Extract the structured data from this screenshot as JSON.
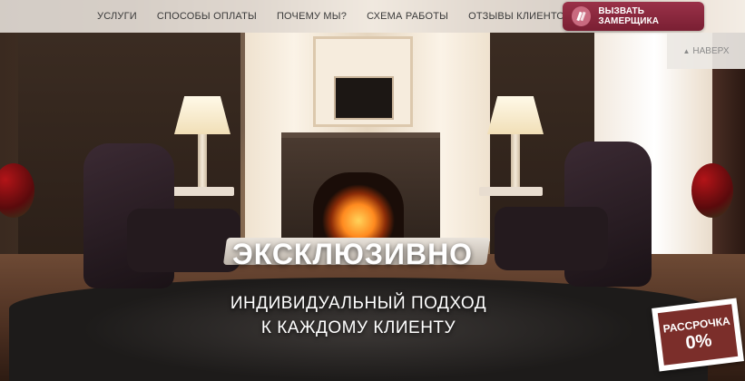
{
  "nav": {
    "items": [
      {
        "label": "УСЛУГИ"
      },
      {
        "label": "СПОСОБЫ ОПЛАТЫ"
      },
      {
        "label": "ПОЧЕМУ МЫ?"
      },
      {
        "label": "СХЕМА РАБОТЫ"
      },
      {
        "label": "ОТЗЫВЫ КЛИЕНТОВ"
      }
    ]
  },
  "cta": {
    "label": "ВЫЗВАТЬ ЗАМЕРЩИКА",
    "icon": "ruler-pencil-icon"
  },
  "to_top": {
    "label": "НАВЕРХ",
    "icon": "arrow-up-icon"
  },
  "hero": {
    "headline": "ЭКСКЛЮЗИВНО",
    "subline_1": "ИНДИВИДУАЛЬНЫЙ ПОДХОД",
    "subline_2": "К КАЖДОМУ КЛИЕНТУ"
  },
  "badge": {
    "label": "РАССРОЧКА",
    "value": "0%"
  },
  "colors": {
    "accent": "#8b2840",
    "badge": "#7b2e2a",
    "nav_bg": "#f5f0ea"
  }
}
